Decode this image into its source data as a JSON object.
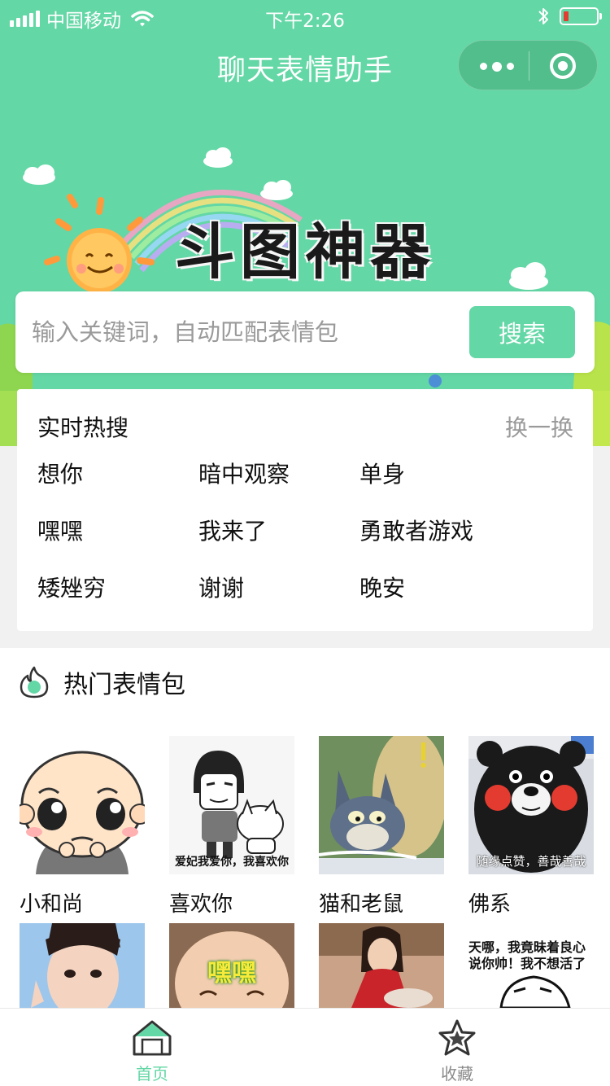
{
  "status_bar": {
    "carrier": "中国移动",
    "time": "下午2:26"
  },
  "nav": {
    "title": "聊天表情助手"
  },
  "banner": {
    "title": "斗图神器"
  },
  "search": {
    "placeholder": "输入关键词，自动匹配表情包",
    "button_label": "搜索"
  },
  "hot_search": {
    "title": "实时热搜",
    "refresh_label": "换一换",
    "items": [
      "想你",
      "暗中观察",
      "单身",
      "嘿嘿",
      "我来了",
      "勇敢者游戏",
      "矮矬穷",
      "谢谢",
      "晚安"
    ]
  },
  "popular": {
    "title": "热门表情包",
    "packs": [
      {
        "name": "小和尚",
        "caption": ""
      },
      {
        "name": "喜欢你",
        "caption": "爱妃我爱你，我喜欢你"
      },
      {
        "name": "猫和老鼠",
        "caption": ""
      },
      {
        "name": "佛系",
        "caption": "随缘点赞，善哉善哉"
      }
    ],
    "more_packs": [
      {
        "caption": ""
      },
      {
        "caption": "嘿嘿"
      },
      {
        "caption": ""
      },
      {
        "caption": "天哪，我竟昧着良心说你帅！我不想活了"
      }
    ]
  },
  "tab_bar": {
    "home_label": "首页",
    "favorites_label": "收藏"
  },
  "colors": {
    "accent": "#63d7a5",
    "tab_inactive": "#8a8a8a",
    "battery_low": "#e23b32"
  }
}
